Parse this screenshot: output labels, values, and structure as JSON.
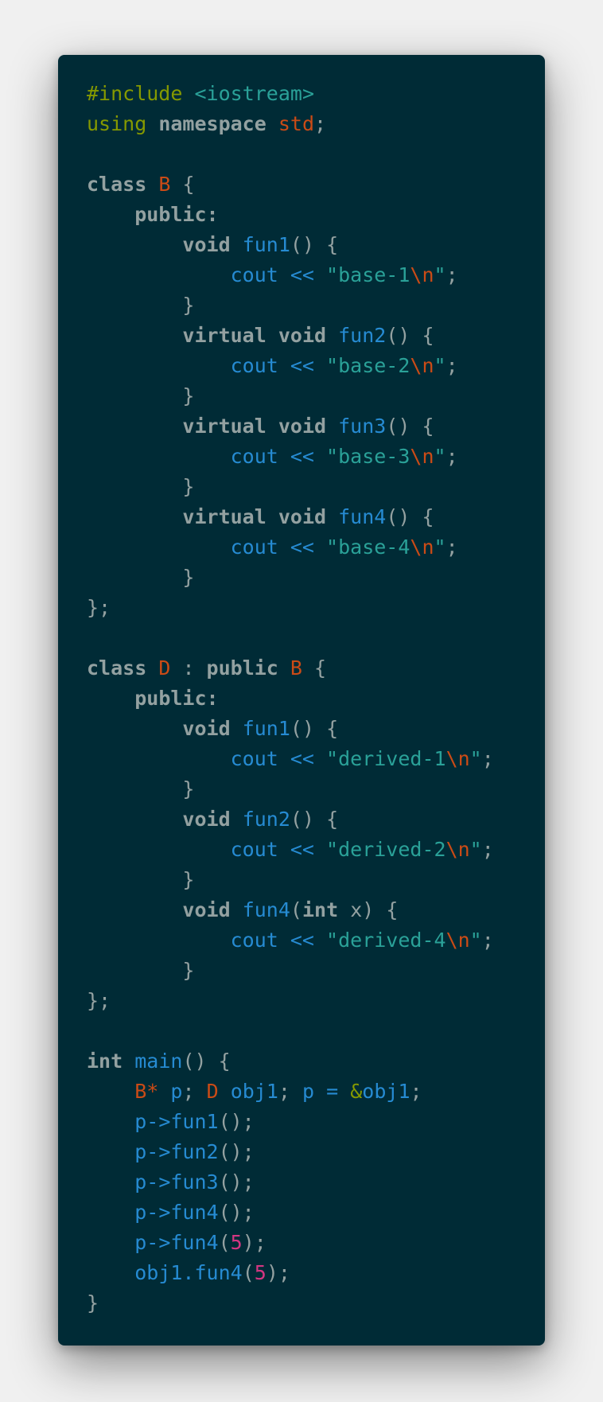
{
  "colors": {
    "page_background": "#f0f0f0",
    "code_background": "#002b36",
    "preprocessor": "#859900",
    "include_path": "#2aa198",
    "keyword": "#93a1a1",
    "type_name": "#cb4b16",
    "function": "#268bd2",
    "identifier": "#268bd2",
    "punctuation": "#93a1a1",
    "string": "#2aa198",
    "escape": "#cb4b16",
    "number": "#d33682"
  },
  "code": {
    "language": "cpp",
    "lines": [
      [
        {
          "t": "pre",
          "v": "#include"
        },
        {
          "t": "plain",
          "v": " "
        },
        {
          "t": "inc",
          "v": "<iostream>"
        }
      ],
      [
        {
          "t": "pre",
          "v": "using"
        },
        {
          "t": "plain",
          "v": " "
        },
        {
          "t": "kw",
          "v": "namespace"
        },
        {
          "t": "plain",
          "v": " "
        },
        {
          "t": "type",
          "v": "std"
        },
        {
          "t": "plain",
          "v": ";"
        }
      ],
      [],
      [
        {
          "t": "kw",
          "v": "class"
        },
        {
          "t": "plain",
          "v": " "
        },
        {
          "t": "type",
          "v": "B"
        },
        {
          "t": "plain",
          "v": " {"
        }
      ],
      [
        {
          "t": "plain",
          "v": "    "
        },
        {
          "t": "kw",
          "v": "public:"
        }
      ],
      [
        {
          "t": "plain",
          "v": "        "
        },
        {
          "t": "kw",
          "v": "void"
        },
        {
          "t": "plain",
          "v": " "
        },
        {
          "t": "func",
          "v": "fun1"
        },
        {
          "t": "plain",
          "v": "() {"
        }
      ],
      [
        {
          "t": "plain",
          "v": "            "
        },
        {
          "t": "ident",
          "v": "cout << "
        },
        {
          "t": "str",
          "v": "\"base-1"
        },
        {
          "t": "esc",
          "v": "\\n"
        },
        {
          "t": "str",
          "v": "\""
        },
        {
          "t": "plain",
          "v": ";"
        }
      ],
      [
        {
          "t": "plain",
          "v": "        }"
        }
      ],
      [
        {
          "t": "plain",
          "v": "        "
        },
        {
          "t": "kw",
          "v": "virtual"
        },
        {
          "t": "plain",
          "v": " "
        },
        {
          "t": "kw",
          "v": "void"
        },
        {
          "t": "plain",
          "v": " "
        },
        {
          "t": "func",
          "v": "fun2"
        },
        {
          "t": "plain",
          "v": "() {"
        }
      ],
      [
        {
          "t": "plain",
          "v": "            "
        },
        {
          "t": "ident",
          "v": "cout << "
        },
        {
          "t": "str",
          "v": "\"base-2"
        },
        {
          "t": "esc",
          "v": "\\n"
        },
        {
          "t": "str",
          "v": "\""
        },
        {
          "t": "plain",
          "v": ";"
        }
      ],
      [
        {
          "t": "plain",
          "v": "        }"
        }
      ],
      [
        {
          "t": "plain",
          "v": "        "
        },
        {
          "t": "kw",
          "v": "virtual"
        },
        {
          "t": "plain",
          "v": " "
        },
        {
          "t": "kw",
          "v": "void"
        },
        {
          "t": "plain",
          "v": " "
        },
        {
          "t": "func",
          "v": "fun3"
        },
        {
          "t": "plain",
          "v": "() {"
        }
      ],
      [
        {
          "t": "plain",
          "v": "            "
        },
        {
          "t": "ident",
          "v": "cout << "
        },
        {
          "t": "str",
          "v": "\"base-3"
        },
        {
          "t": "esc",
          "v": "\\n"
        },
        {
          "t": "str",
          "v": "\""
        },
        {
          "t": "plain",
          "v": ";"
        }
      ],
      [
        {
          "t": "plain",
          "v": "        }"
        }
      ],
      [
        {
          "t": "plain",
          "v": "        "
        },
        {
          "t": "kw",
          "v": "virtual"
        },
        {
          "t": "plain",
          "v": " "
        },
        {
          "t": "kw",
          "v": "void"
        },
        {
          "t": "plain",
          "v": " "
        },
        {
          "t": "func",
          "v": "fun4"
        },
        {
          "t": "plain",
          "v": "() {"
        }
      ],
      [
        {
          "t": "plain",
          "v": "            "
        },
        {
          "t": "ident",
          "v": "cout << "
        },
        {
          "t": "str",
          "v": "\"base-4"
        },
        {
          "t": "esc",
          "v": "\\n"
        },
        {
          "t": "str",
          "v": "\""
        },
        {
          "t": "plain",
          "v": ";"
        }
      ],
      [
        {
          "t": "plain",
          "v": "        }"
        }
      ],
      [
        {
          "t": "plain",
          "v": "};"
        }
      ],
      [],
      [
        {
          "t": "kw",
          "v": "class"
        },
        {
          "t": "plain",
          "v": " "
        },
        {
          "t": "type",
          "v": "D"
        },
        {
          "t": "plain",
          "v": " : "
        },
        {
          "t": "kw",
          "v": "public"
        },
        {
          "t": "plain",
          "v": " "
        },
        {
          "t": "type",
          "v": "B"
        },
        {
          "t": "plain",
          "v": " {"
        }
      ],
      [
        {
          "t": "plain",
          "v": "    "
        },
        {
          "t": "kw",
          "v": "public:"
        }
      ],
      [
        {
          "t": "plain",
          "v": "        "
        },
        {
          "t": "kw",
          "v": "void"
        },
        {
          "t": "plain",
          "v": " "
        },
        {
          "t": "func",
          "v": "fun1"
        },
        {
          "t": "plain",
          "v": "() {"
        }
      ],
      [
        {
          "t": "plain",
          "v": "            "
        },
        {
          "t": "ident",
          "v": "cout << "
        },
        {
          "t": "str",
          "v": "\"derived-1"
        },
        {
          "t": "esc",
          "v": "\\n"
        },
        {
          "t": "str",
          "v": "\""
        },
        {
          "t": "plain",
          "v": ";"
        }
      ],
      [
        {
          "t": "plain",
          "v": "        }"
        }
      ],
      [
        {
          "t": "plain",
          "v": "        "
        },
        {
          "t": "kw",
          "v": "void"
        },
        {
          "t": "plain",
          "v": " "
        },
        {
          "t": "func",
          "v": "fun2"
        },
        {
          "t": "plain",
          "v": "() {"
        }
      ],
      [
        {
          "t": "plain",
          "v": "            "
        },
        {
          "t": "ident",
          "v": "cout << "
        },
        {
          "t": "str",
          "v": "\"derived-2"
        },
        {
          "t": "esc",
          "v": "\\n"
        },
        {
          "t": "str",
          "v": "\""
        },
        {
          "t": "plain",
          "v": ";"
        }
      ],
      [
        {
          "t": "plain",
          "v": "        }"
        }
      ],
      [
        {
          "t": "plain",
          "v": "        "
        },
        {
          "t": "kw",
          "v": "void"
        },
        {
          "t": "plain",
          "v": " "
        },
        {
          "t": "func",
          "v": "fun4"
        },
        {
          "t": "plain",
          "v": "("
        },
        {
          "t": "kw",
          "v": "int"
        },
        {
          "t": "plain",
          "v": " x) {"
        }
      ],
      [
        {
          "t": "plain",
          "v": "            "
        },
        {
          "t": "ident",
          "v": "cout << "
        },
        {
          "t": "str",
          "v": "\"derived-4"
        },
        {
          "t": "esc",
          "v": "\\n"
        },
        {
          "t": "str",
          "v": "\""
        },
        {
          "t": "plain",
          "v": ";"
        }
      ],
      [
        {
          "t": "plain",
          "v": "        }"
        }
      ],
      [
        {
          "t": "plain",
          "v": "};"
        }
      ],
      [],
      [
        {
          "t": "kw",
          "v": "int"
        },
        {
          "t": "plain",
          "v": " "
        },
        {
          "t": "func",
          "v": "main"
        },
        {
          "t": "plain",
          "v": "() {"
        }
      ],
      [
        {
          "t": "plain",
          "v": "    "
        },
        {
          "t": "type",
          "v": "B*"
        },
        {
          "t": "plain",
          "v": " "
        },
        {
          "t": "ident",
          "v": "p"
        },
        {
          "t": "plain",
          "v": "; "
        },
        {
          "t": "type",
          "v": "D"
        },
        {
          "t": "plain",
          "v": " "
        },
        {
          "t": "ident",
          "v": "obj1"
        },
        {
          "t": "plain",
          "v": "; "
        },
        {
          "t": "ident",
          "v": "p = "
        },
        {
          "t": "amp",
          "v": "&"
        },
        {
          "t": "ident",
          "v": "obj1"
        },
        {
          "t": "plain",
          "v": ";"
        }
      ],
      [
        {
          "t": "plain",
          "v": "    "
        },
        {
          "t": "ident",
          "v": "p->fun1"
        },
        {
          "t": "plain",
          "v": "();"
        }
      ],
      [
        {
          "t": "plain",
          "v": "    "
        },
        {
          "t": "ident",
          "v": "p->fun2"
        },
        {
          "t": "plain",
          "v": "();"
        }
      ],
      [
        {
          "t": "plain",
          "v": "    "
        },
        {
          "t": "ident",
          "v": "p->fun3"
        },
        {
          "t": "plain",
          "v": "();"
        }
      ],
      [
        {
          "t": "plain",
          "v": "    "
        },
        {
          "t": "ident",
          "v": "p->fun4"
        },
        {
          "t": "plain",
          "v": "();"
        }
      ],
      [
        {
          "t": "plain",
          "v": "    "
        },
        {
          "t": "ident",
          "v": "p->fun4"
        },
        {
          "t": "plain",
          "v": "("
        },
        {
          "t": "num",
          "v": "5"
        },
        {
          "t": "plain",
          "v": ");"
        }
      ],
      [
        {
          "t": "plain",
          "v": "    "
        },
        {
          "t": "ident",
          "v": "obj1.fun4"
        },
        {
          "t": "plain",
          "v": "("
        },
        {
          "t": "num",
          "v": "5"
        },
        {
          "t": "plain",
          "v": ");"
        }
      ],
      [
        {
          "t": "plain",
          "v": "}"
        }
      ]
    ]
  }
}
